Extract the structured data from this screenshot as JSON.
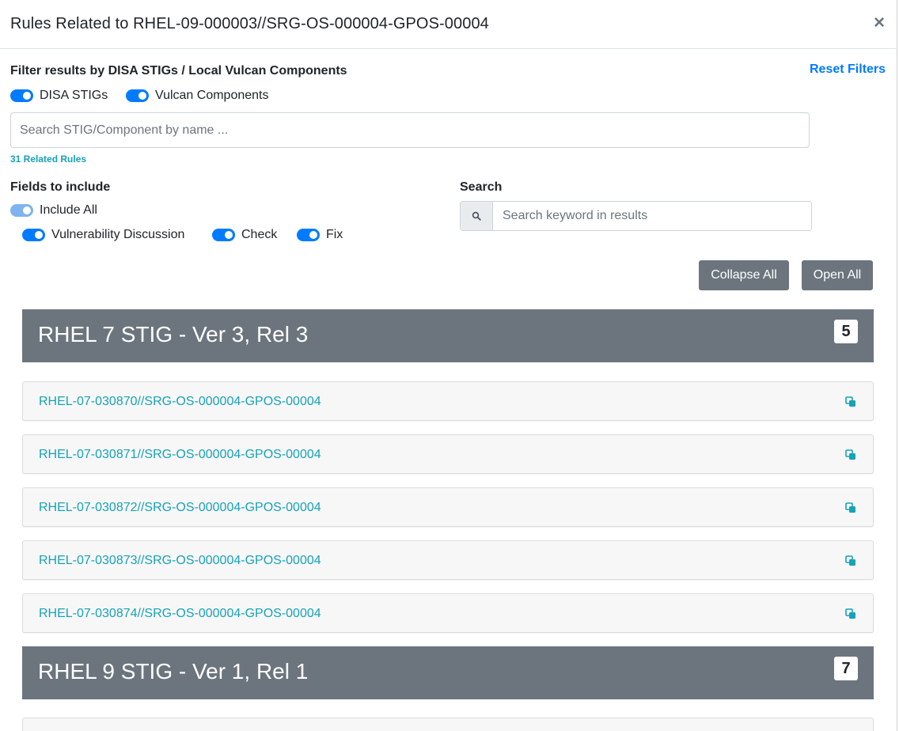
{
  "modal": {
    "title": "Rules Related to RHEL-09-000003//SRG-OS-000004-GPOS-00004",
    "close_label": "×"
  },
  "filters": {
    "label": "Filter results by DISA STIGs / Local Vulcan Components",
    "reset_label": "Reset Filters",
    "toggles": [
      {
        "label": "DISA STIGs",
        "checked": true
      },
      {
        "label": "Vulcan Components",
        "checked": true
      }
    ],
    "search_placeholder": "Search STIG/Component by name ...",
    "related_count": "31 Related Rules"
  },
  "fields": {
    "label": "Fields to include",
    "include_all": {
      "label": "Include All",
      "checked": true
    },
    "options": [
      {
        "label": "Vulnerability Discussion",
        "checked": true
      },
      {
        "label": "Check",
        "checked": true
      },
      {
        "label": "Fix",
        "checked": true
      }
    ]
  },
  "search": {
    "label": "Search",
    "placeholder": "Search keyword in results"
  },
  "actions": {
    "collapse_all": "Collapse All",
    "open_all": "Open All"
  },
  "groups": [
    {
      "title": "RHEL 7 STIG - Ver 3, Rel 3",
      "count": "5",
      "rules": [
        "RHEL-07-030870//SRG-OS-000004-GPOS-00004",
        "RHEL-07-030871//SRG-OS-000004-GPOS-00004",
        "RHEL-07-030872//SRG-OS-000004-GPOS-00004",
        "RHEL-07-030873//SRG-OS-000004-GPOS-00004",
        "RHEL-07-030874//SRG-OS-000004-GPOS-00004"
      ]
    },
    {
      "title": "RHEL 9 STIG - Ver 1, Rel 1",
      "count": "7",
      "rules": []
    }
  ],
  "colors": {
    "primary": "#007bff",
    "info": "#17a2b8",
    "secondary": "#6c757d"
  }
}
